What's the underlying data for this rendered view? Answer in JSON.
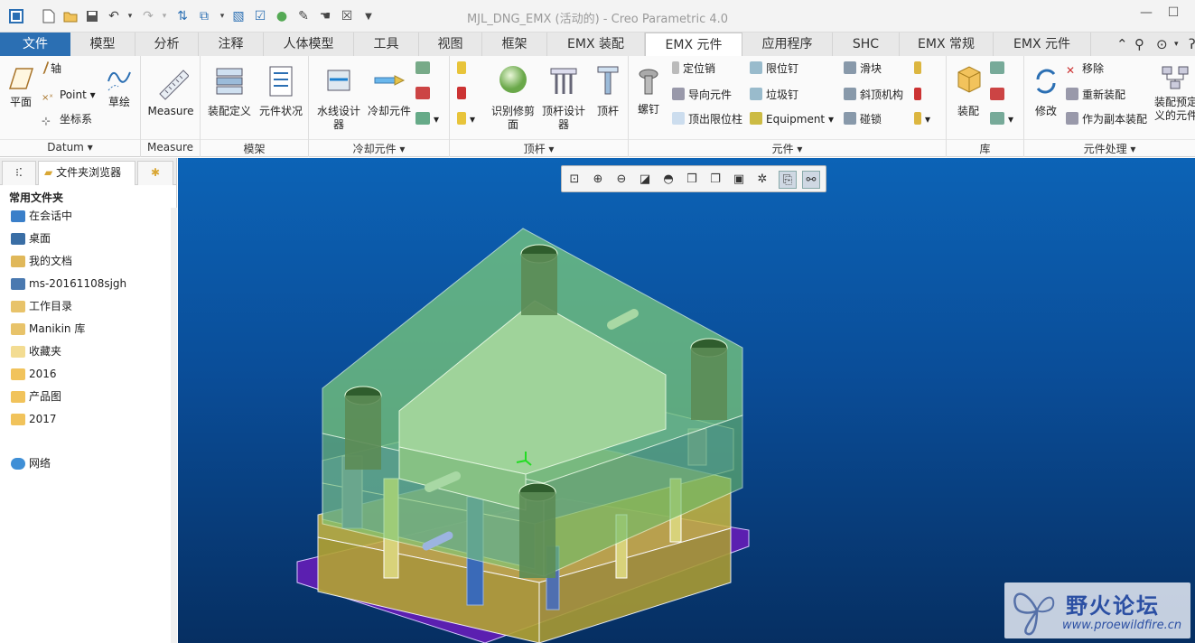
{
  "title": "MJL_DNG_EMX (活动的) - Creo Parametric 4.0",
  "quick_access": [
    "app-icon",
    "new-icon",
    "open-icon",
    "save-icon",
    "undo-icon",
    "redo-icon",
    "regenerate-icon",
    "windows-icon",
    "mesh-icon",
    "checkbox-icon",
    "sphere-icon",
    "edit-icon",
    "hand-icon",
    "close-window-icon",
    "dropdown-icon"
  ],
  "tabs": [
    "文件",
    "模型",
    "分析",
    "注释",
    "人体模型",
    "工具",
    "视图",
    "框架",
    "EMX 装配",
    "EMX 元件",
    "应用程序",
    "SHC",
    "EMX 常规",
    "EMX 元件"
  ],
  "ribbon": {
    "datum": {
      "label": "Datum ▾",
      "plane": "平面",
      "axis": "轴",
      "point": "Point",
      "coords": "坐标系",
      "sketch": "草绘"
    },
    "measure": {
      "label": "Measure",
      "button": "Measure"
    },
    "moldbase": {
      "label": "模架",
      "assembly_def": "装配定义",
      "component_status": "元件状况"
    },
    "cooling": {
      "label": "冷却元件 ▾",
      "waterline": "水线设计器",
      "cooling_comp": "冷却元件"
    },
    "ejector": {
      "label": "顶杆 ▾",
      "identify": "识别修剪面",
      "pin_designer": "顶杆设计器",
      "pin": "顶杆"
    },
    "components": {
      "label": "元件 ▾",
      "screw": "螺钉",
      "locating_pin": "定位销",
      "guide": "导向元件",
      "ejector_stop": "顶出限位柱",
      "stop_pin": "限位钉",
      "trash_pin": "垃圾钉",
      "equipment": "Equipment",
      "slider": "滑块",
      "lifter": "斜顶机构",
      "lock": "碰锁"
    },
    "library": {
      "label": "库",
      "assemble": "装配"
    },
    "comp_process": {
      "label": "元件处理 ▾",
      "modify": "修改",
      "remove": "移除",
      "reassemble": "重新装配",
      "as_copy": "作为副本装配",
      "predefined_1": "装配预定",
      "predefined_2": "义的元件"
    }
  },
  "left_panel": {
    "tab_browser": "文件夹浏览器",
    "favorites_title": "常用文件夹",
    "folders": [
      "在会话中",
      "桌面",
      "我的文档",
      "ms-20161108sjgh",
      "工作目录",
      "Manikin 库",
      "收藏夹",
      "2016",
      "产品图",
      "2017"
    ],
    "network": "网络"
  },
  "watermark": {
    "brand": "野火论坛",
    "url": "www.proewildfire.cn"
  },
  "colors": {
    "accent": "#2b6fb3",
    "viewport_top": "#0c63b6",
    "viewport_bottom": "#062f62"
  }
}
